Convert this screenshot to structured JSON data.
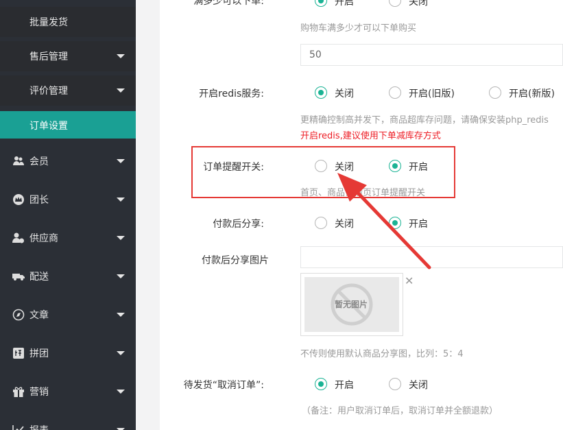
{
  "sidebar": {
    "sub_items": [
      {
        "label": "批量发货",
        "caret": false,
        "active": false
      },
      {
        "label": "售后管理",
        "caret": true,
        "active": false
      },
      {
        "label": "评价管理",
        "caret": true,
        "active": false
      },
      {
        "label": "订单设置",
        "caret": false,
        "active": true
      }
    ],
    "menu_items": [
      {
        "label": "会员",
        "icon": "users-icon"
      },
      {
        "label": "团长",
        "icon": "crown-icon"
      },
      {
        "label": "供应商",
        "icon": "supplier-icon"
      },
      {
        "label": "配送",
        "icon": "truck-icon"
      },
      {
        "label": "文章",
        "icon": "compass-icon"
      },
      {
        "label": "拼团",
        "icon": "group-buy-icon"
      },
      {
        "label": "营销",
        "icon": "gift-icon"
      },
      {
        "label": "报表",
        "icon": "chart-icon"
      }
    ]
  },
  "settings": {
    "min_order": {
      "label": "满多少可以下单:",
      "opt_on": "开启",
      "opt_off": "关闭",
      "hint": "购物车满多少才可以下单购买",
      "value": "50"
    },
    "redis": {
      "label": "开启redis服务:",
      "opt_off": "关闭",
      "opt_old": "开启(旧版)",
      "opt_new": "开启(新版)",
      "hint": "更精确控制高并发下，商品超库存问题，请确保安装php_redis",
      "warning": "开启redis,建议使用下单减库存方式"
    },
    "order_reminder": {
      "label": "订单提醒开关:",
      "opt_off": "关闭",
      "opt_on": "开启",
      "hint": "首页、商品详情页订单提醒开关"
    },
    "share_after_pay": {
      "label": "付款后分享:",
      "opt_off": "关闭",
      "opt_on": "开启"
    },
    "share_image": {
      "label": "付款后分享图片",
      "placeholder_text": "暂无图片",
      "hint": "不传则使用默认商品分享图，比列：5：4"
    },
    "cancel_pending": {
      "label": "待发货“取消订单”:",
      "opt_on": "开启",
      "opt_off": "关闭",
      "hint": "（备注：用户取消订单后，取消订单并全额退款）"
    }
  },
  "colors": {
    "accent": "#1ab394",
    "active_menu": "#1aa094",
    "sidebar_bg": "#2b2f36",
    "highlight": "#e53935",
    "warning": "#ed1c24"
  }
}
